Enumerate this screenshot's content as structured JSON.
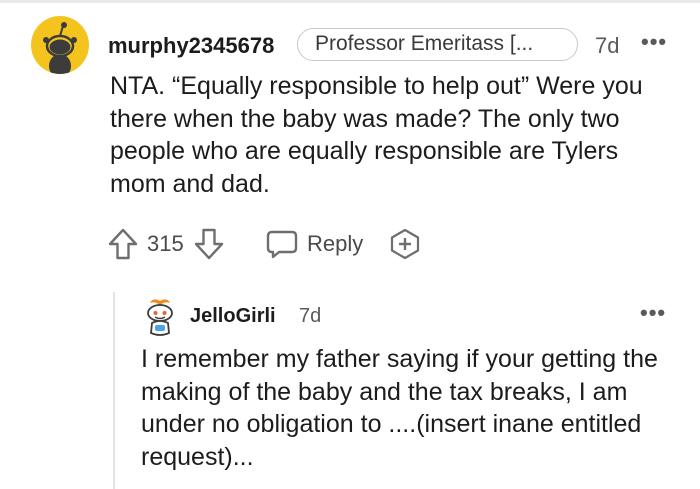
{
  "comment": {
    "username": "murphy2345678",
    "flair": "Professor Emeritass [...",
    "time": "7d",
    "more": "•••",
    "body": "NTA. “Equally responsible to help out” Were you there when the baby was made? The only two people who are equally responsible are Tylers mom and dad.",
    "actions": {
      "score": "315",
      "reply_label": "Reply"
    }
  },
  "reply": {
    "username": "JelloGirli",
    "time": "7d",
    "more": "•••",
    "body": "I remember my father saying if your getting the making of the baby and the tax breaks, I am under no obligation to ....(insert inane entitled request)..."
  },
  "colors": {
    "avatar_bg": "#f4c31d",
    "text": "#1c1c1c",
    "meta": "#5a5a5a",
    "icon": "#6e6e6e"
  }
}
